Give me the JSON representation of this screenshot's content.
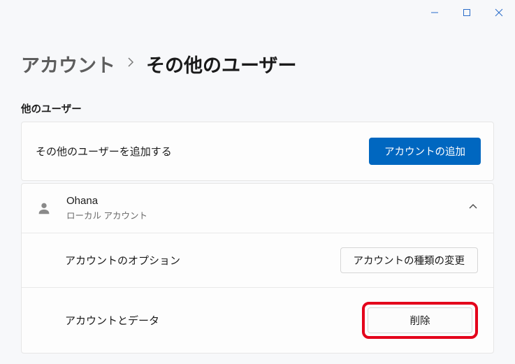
{
  "breadcrumb": {
    "parent": "アカウント",
    "current": "その他のユーザー"
  },
  "section": {
    "label": "他のユーザー"
  },
  "add_user": {
    "text": "その他のユーザーを追加する",
    "button": "アカウントの追加"
  },
  "user": {
    "name": "Ohana",
    "type": "ローカル アカウント"
  },
  "options": {
    "account_options_label": "アカウントのオプション",
    "change_type_button": "アカウントの種類の変更",
    "account_data_label": "アカウントとデータ",
    "delete_button": "削除"
  }
}
